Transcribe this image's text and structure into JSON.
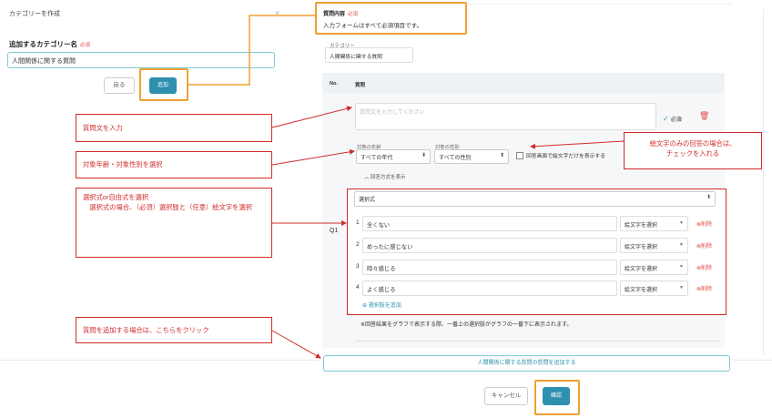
{
  "modal": {
    "title": "カテゴリーを作成",
    "close": "×",
    "field_label": "追加するカテゴリー名",
    "required": "必須",
    "input_value": "人間関係に関する質問",
    "back_label": "戻る",
    "add_label": "追加"
  },
  "form": {
    "section_title": "質問内容",
    "section_required": "必須",
    "section_sub": "入力フォームはすべて必須項目です。",
    "category_label": "カテゴリー",
    "category_value": "人間関係に関する質問",
    "col_no": "No.",
    "col_question": "質問",
    "q_number": "Q1",
    "question_placeholder": "質問文を入力してください",
    "required_check": "必須",
    "age_label": "対象の年齢",
    "age_value": "すべての年代",
    "gender_label": "対象の性別",
    "gender_value": "すべての性別",
    "emoji_only_label": "回答画面で絵文字だけを表示する",
    "toggle_answers": "回答方式を表示",
    "answer_type": "選択式",
    "options": [
      {
        "num": "1",
        "text": "全くない",
        "emoji": "絵文字を選択",
        "del": "削除"
      },
      {
        "num": "2",
        "text": "めったに感じない",
        "emoji": "絵文字を選択",
        "del": "削除"
      },
      {
        "num": "3",
        "text": "時々感じる",
        "emoji": "絵文字を選択",
        "del": "削除"
      },
      {
        "num": "4",
        "text": "よく感じる",
        "emoji": "絵文字を選択",
        "del": "削除"
      }
    ],
    "add_choice": "選択肢を追加",
    "note": "※回答結果をグラフで表示する際、一番上の選択肢がグラフの一番下に表示されます。",
    "add_question": "人間関係に関する質問の質問を追加する",
    "cancel_label": "キャンセル",
    "confirm_label": "確認"
  },
  "callouts": {
    "question_text": "質問文を入力",
    "target": "対象年齢・対象性別を選択",
    "answer_type": "選択式or自由式を選択\n　選択式の場合、（必須）選択肢と（任意）絵文字を選択",
    "emoji_only": "絵文字のみの回答の場合は、\nチェックを入れる",
    "add_question": "質問を追加する場合は、こちらをクリック"
  },
  "colors": {
    "accent": "#2e8fae",
    "annotation_red": "#d12b2b",
    "highlight_orange": "#f0a030"
  }
}
